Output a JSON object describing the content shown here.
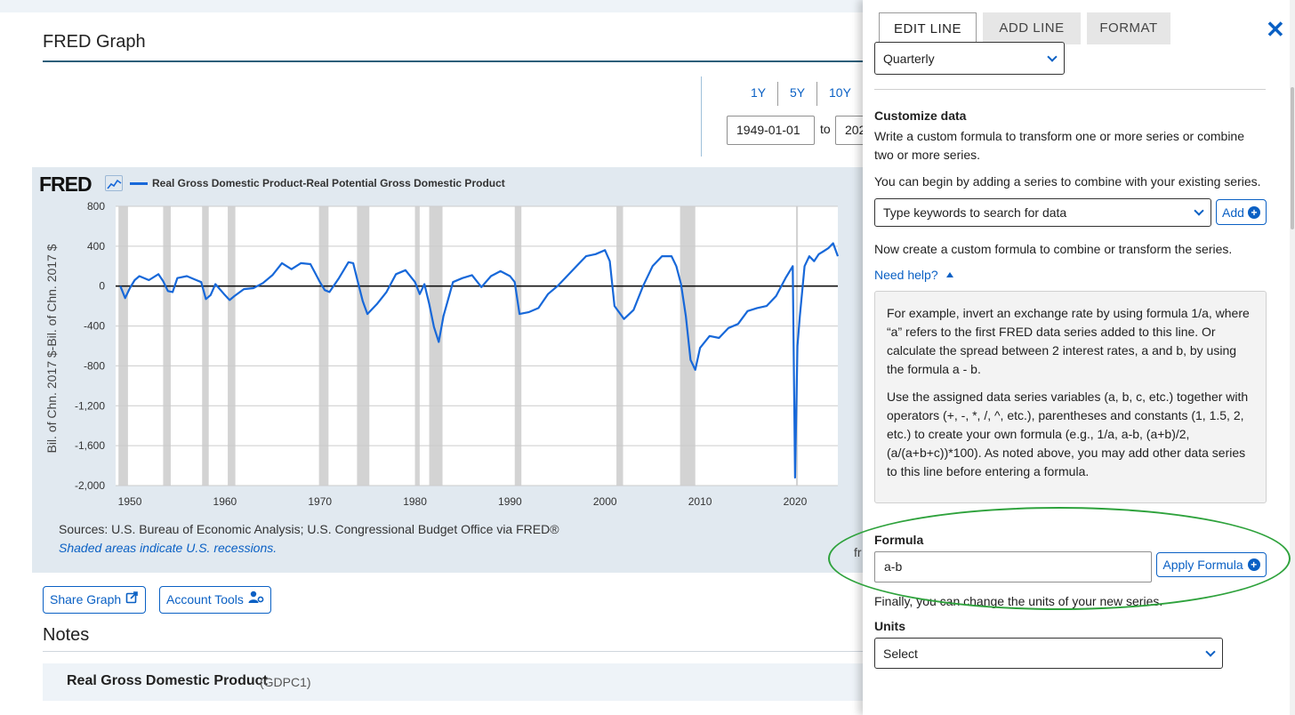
{
  "page": {
    "title": "FRED Graph",
    "range_buttons": [
      "1Y",
      "5Y",
      "10Y"
    ],
    "start_date": "1949-01-01",
    "to_label": "to",
    "end_date_visible": "202"
  },
  "chart": {
    "logo": "FRED",
    "legend_label": "Real Gross Domestic Product-Real Potential Gross Domestic Product",
    "y_axis_title": "Bil. of Chn. 2017 $-Bil. of Chn. 2017 $",
    "sources": "Sources: U.S. Bureau of Economic Analysis; U.S. Congressional Budget Office via FRED®",
    "shaded_note": "Shaded areas indicate U.S. recessions.",
    "clipped_text": "fr"
  },
  "chart_data": {
    "type": "line",
    "title": "",
    "xlabel": "",
    "ylabel": "Bil. of Chn. 2017 $-Bil. of Chn. 2017 $",
    "xlim": [
      1948.5,
      2024.5
    ],
    "ylim": [
      -2000,
      800
    ],
    "x_ticks": [
      1950,
      1960,
      1970,
      1980,
      1990,
      2000,
      2010,
      2020
    ],
    "y_ticks": [
      800,
      400,
      0,
      -400,
      -800,
      -1200,
      -1600,
      -2000
    ],
    "y_tick_labels": [
      "800",
      "400",
      "0",
      "-400",
      "-800",
      "-1,200",
      "-1,600",
      "-2,000"
    ],
    "color": "#1768d9",
    "series": [
      {
        "name": "Real Gross Domestic Product-Real Potential Gross Domestic Product",
        "x": [
          1949,
          1949.5,
          1950,
          1950.5,
          1951,
          1952,
          1953,
          1953.5,
          1954,
          1954.5,
          1955,
          1956,
          1957,
          1957.5,
          1958,
          1958.5,
          1959,
          1960,
          1960.5,
          1961,
          1962,
          1963,
          1964,
          1965,
          1966,
          1967,
          1968,
          1969,
          1969.5,
          1970,
          1970.5,
          1971,
          1972,
          1973,
          1973.5,
          1974,
          1974.5,
          1975,
          1976,
          1977,
          1978,
          1979,
          1980,
          1980.5,
          1981,
          1981.5,
          1982,
          1982.5,
          1983,
          1984,
          1985,
          1986,
          1987,
          1988,
          1989,
          1990,
          1990.5,
          1991,
          1992,
          1993,
          1994,
          1995,
          1996,
          1997,
          1998,
          1999,
          2000,
          2000.5,
          2001,
          2002,
          2003,
          2004,
          2005,
          2006,
          2007,
          2007.5,
          2008,
          2008.5,
          2009,
          2009.5,
          2010,
          2011,
          2012,
          2013,
          2014,
          2015,
          2016,
          2017,
          2018,
          2019,
          2019.75,
          2020,
          2020.25,
          2020.5,
          2021,
          2021.5,
          2022,
          2022.5,
          2023,
          2023.5,
          2024,
          2024.5
        ],
        "values": [
          0,
          -120,
          -20,
          60,
          100,
          60,
          120,
          50,
          -50,
          -60,
          80,
          100,
          60,
          40,
          -130,
          -90,
          20,
          -90,
          -140,
          -100,
          -30,
          -20,
          30,
          110,
          230,
          170,
          230,
          220,
          130,
          40,
          -40,
          -60,
          80,
          240,
          230,
          40,
          -150,
          -280,
          -180,
          -60,
          120,
          160,
          40,
          -80,
          20,
          -180,
          -410,
          -560,
          -300,
          40,
          80,
          110,
          -10,
          100,
          150,
          100,
          40,
          -280,
          -260,
          -220,
          -80,
          0,
          100,
          200,
          300,
          320,
          360,
          250,
          -200,
          -330,
          -240,
          0,
          200,
          300,
          300,
          200,
          20,
          -300,
          -740,
          -840,
          -620,
          -500,
          -520,
          -420,
          -380,
          -250,
          -220,
          -200,
          -100,
          80,
          200,
          -1920,
          -600,
          -300,
          200,
          300,
          250,
          320,
          350,
          380,
          430,
          300
        ]
      }
    ],
    "recessions": [
      [
        1948.8,
        1949.8
      ],
      [
        1953.5,
        1954.3
      ],
      [
        1957.6,
        1958.3
      ],
      [
        1960.3,
        1961.1
      ],
      [
        1969.9,
        1970.9
      ],
      [
        1973.9,
        1975.2
      ],
      [
        1980.0,
        1980.5
      ],
      [
        1981.5,
        1982.9
      ],
      [
        1990.5,
        1991.2
      ],
      [
        2001.2,
        2001.9
      ],
      [
        2007.9,
        2009.5
      ],
      [
        2020.1,
        2020.3
      ]
    ]
  },
  "actions": {
    "share_label": "Share Graph",
    "account_label": "Account Tools"
  },
  "notes": {
    "title": "Notes",
    "series_name": "Real Gross Domestic Product",
    "series_id": "(GDPC1)"
  },
  "panel": {
    "tabs": [
      "EDIT LINE",
      "ADD LINE",
      "FORMAT"
    ],
    "frequency_value": "Quarterly",
    "customize_title": "Customize data",
    "customize_desc": "Write a custom formula to transform one or more series or combine two or more series.",
    "begin_text": "You can begin by adding a series to combine with your existing series.",
    "search_placeholder": "Type keywords to search for data",
    "add_label": "Add",
    "now_create_text": "Now create a custom formula to combine or transform the series.",
    "need_help": "Need help?",
    "help_p1": "For example, invert an exchange rate by using formula 1/a, where “a” refers to the first FRED data series added to this line. Or calculate the spread between 2 interest rates, a and b, by using the formula a - b.",
    "help_p2": "Use the assigned data series variables (a, b, c, etc.) together with operators (+, -, *, /, ^, etc.), parentheses and constants (1, 1.5, 2, etc.) to create your own formula (e.g., 1/a, a-b, (a+b)/2, (a/(a+b+c))*100). As noted above, you may add other data series to this line before entering a formula.",
    "formula_label": "Formula",
    "formula_value": "a-b",
    "apply_label": "Apply Formula",
    "units_text": "Finally, you can change the units of your new series.",
    "units_label": "Units",
    "units_value": "Select",
    "close_symbol": "✕"
  },
  "colors": {
    "accent": "#0a60c4",
    "line": "#1768d9",
    "chart_bg": "#e1e9f0",
    "annotation": "#2ea23c"
  }
}
